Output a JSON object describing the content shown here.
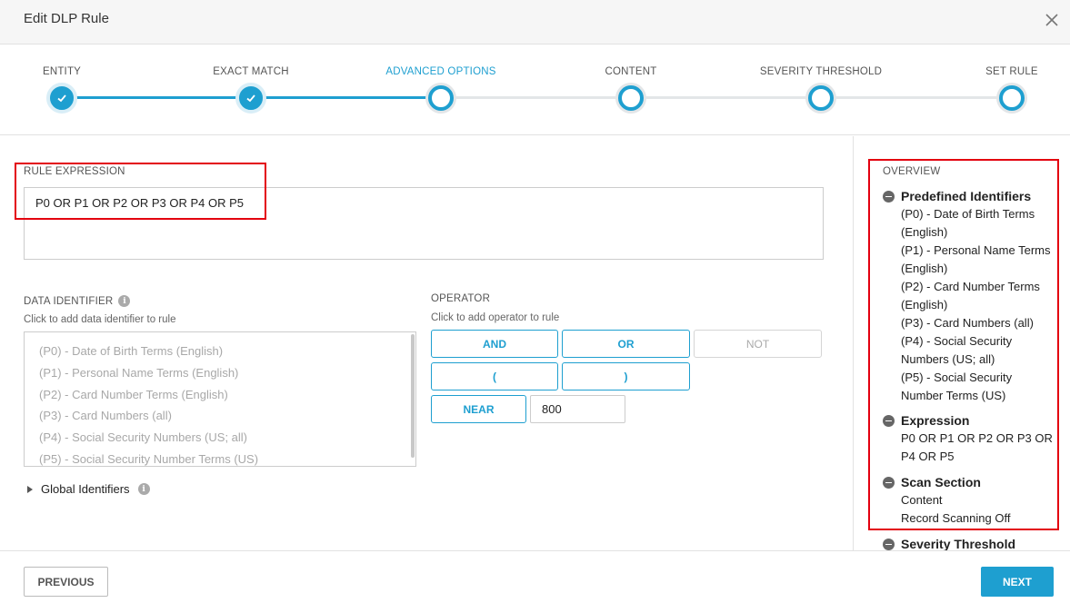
{
  "dialog": {
    "title": "Edit DLP Rule"
  },
  "steps": [
    {
      "label": "ENTITY",
      "state": "done"
    },
    {
      "label": "EXACT MATCH",
      "state": "done"
    },
    {
      "label": "ADVANCED OPTIONS",
      "state": "active"
    },
    {
      "label": "CONTENT",
      "state": "todo"
    },
    {
      "label": "SEVERITY THRESHOLD",
      "state": "todo"
    },
    {
      "label": "SET RULE",
      "state": "todo"
    }
  ],
  "rule_expression": {
    "label": "RULE EXPRESSION",
    "value": "P0 OR P1 OR P2 OR P3 OR P4 OR P5"
  },
  "data_identifier": {
    "label": "DATA IDENTIFIER",
    "hint": "Click to add data identifier to rule",
    "items": [
      "(P0) - Date of Birth Terms (English)",
      "(P1) - Personal Name Terms (English)",
      "(P2) - Card Number Terms (English)",
      "(P3) - Card Numbers (all)",
      "(P4) - Social Security Numbers (US; all)",
      "(P5) - Social Security Number Terms (US)"
    ],
    "global_label": "Global Identifiers"
  },
  "operator": {
    "label": "OPERATOR",
    "hint": "Click to add operator to rule",
    "and": "AND",
    "or": "OR",
    "not": "NOT",
    "open_paren": "(",
    "close_paren": ")",
    "near": "NEAR",
    "near_value": "800"
  },
  "overview": {
    "title": "OVERVIEW",
    "predefined": {
      "heading": "Predefined Identifiers",
      "lines": [
        "(P0) - Date of Birth Terms (English)",
        "(P1) - Personal Name Terms (English)",
        "(P2) - Card Number Terms (English)",
        "(P3) - Card Numbers (all)",
        "(P4) - Social Security Numbers (US; all)",
        "(P5) - Social Security Number Terms (US)"
      ]
    },
    "expression": {
      "heading": "Expression",
      "value": "P0 OR P1 OR P2 OR P3 OR P4 OR P5"
    },
    "scan_section": {
      "heading": "Scan Section",
      "lines": [
        "Content",
        "Record Scanning Off"
      ]
    },
    "severity": {
      "heading": "Severity Threshold"
    }
  },
  "footer": {
    "previous": "PREVIOUS",
    "next": "NEXT"
  },
  "colors": {
    "accent": "#1e9fd0",
    "highlight": "#e3000f"
  },
  "icons": [
    "close-icon",
    "checkmark-icon",
    "info-icon",
    "expand-triangle-icon",
    "collapse-minus-icon"
  ]
}
